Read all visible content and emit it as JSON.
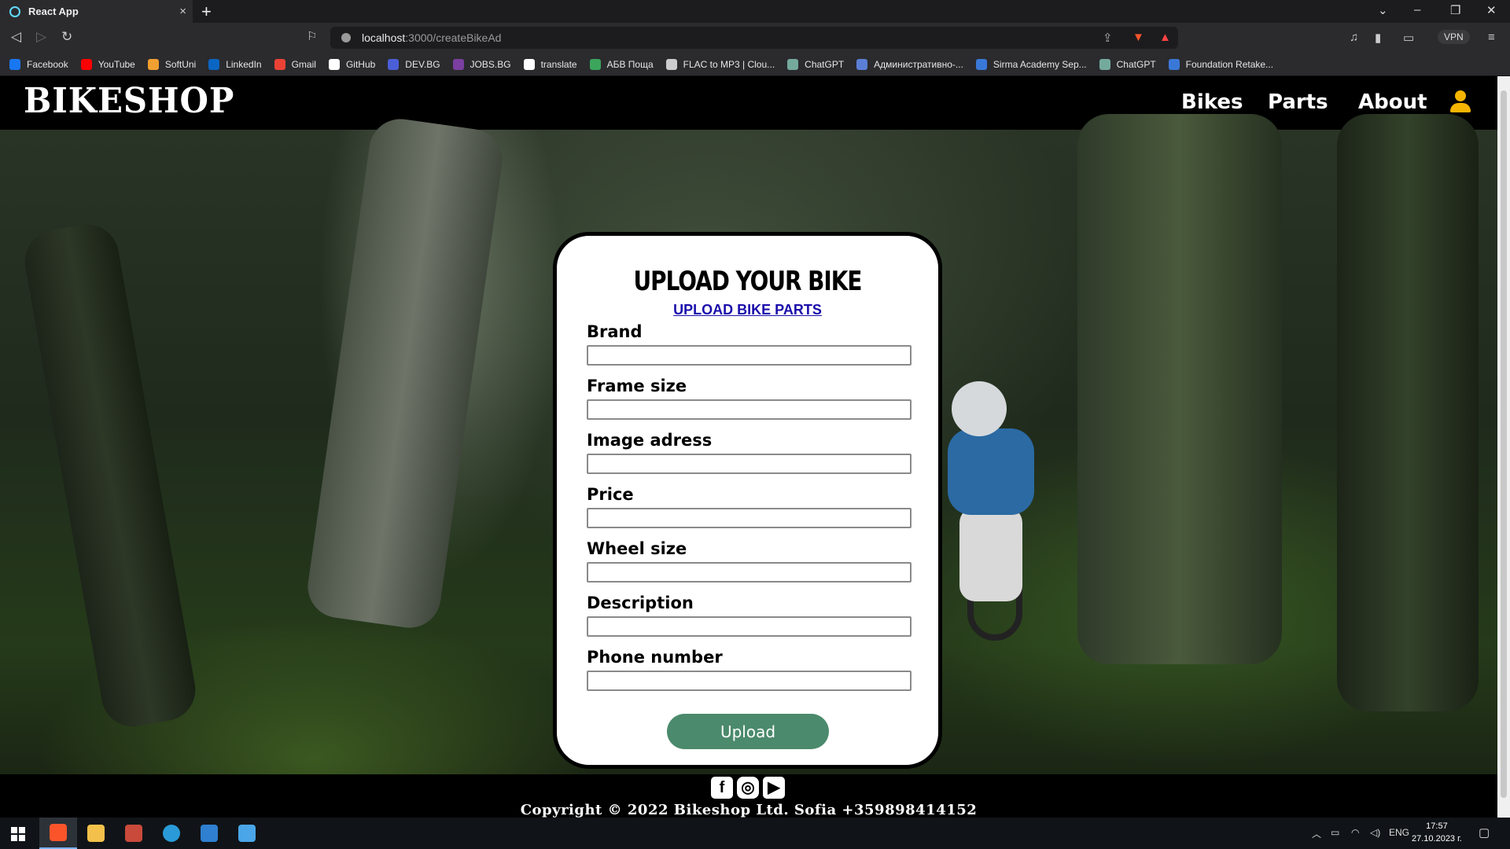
{
  "browser": {
    "tab_title": "React App",
    "tab_close": "×",
    "new_tab": "+",
    "url_host": "localhost",
    "url_path": ":3000/createBikeAd",
    "vpn_label": "VPN",
    "back": "◁",
    "forward": "▷",
    "reload": "↻",
    "minimize": "–",
    "maximize": "❐",
    "close": "✕",
    "tab_list": "⌄",
    "bookmarks": [
      {
        "label": "Facebook",
        "color": "#1877f2"
      },
      {
        "label": "YouTube",
        "color": "#ff0000"
      },
      {
        "label": "SoftUni",
        "color": "#f0a030"
      },
      {
        "label": "LinkedIn",
        "color": "#0a66c2"
      },
      {
        "label": "Gmail",
        "color": "#ea4335"
      },
      {
        "label": "GitHub",
        "color": "#ffffff"
      },
      {
        "label": "DEV.BG",
        "color": "#4a5fd8"
      },
      {
        "label": "JOBS.BG",
        "color": "#7b3fa0"
      },
      {
        "label": "translate",
        "color": "#ffffff"
      },
      {
        "label": "АБВ Поща",
        "color": "#3ba55c"
      },
      {
        "label": "FLAC to MP3 | Clou...",
        "color": "#cccccc"
      },
      {
        "label": "ChatGPT",
        "color": "#74aa9c"
      },
      {
        "label": "Административно-...",
        "color": "#5b7fd6"
      },
      {
        "label": "Sirma Academy Sep...",
        "color": "#3a78d8"
      },
      {
        "label": "ChatGPT",
        "color": "#74aa9c"
      },
      {
        "label": "Foundation Retake...",
        "color": "#3a78d8"
      }
    ]
  },
  "site": {
    "logo": "BIKESHOP",
    "nav": {
      "bikes": "Bikes",
      "parts": "Parts",
      "about": "About"
    },
    "accent_color": "#f5b400"
  },
  "form": {
    "title": "UPLOAD YOUR BIKE",
    "link": "UPLOAD BIKE PARTS",
    "fields": [
      {
        "label": "Brand",
        "value": ""
      },
      {
        "label": "Frame size",
        "value": ""
      },
      {
        "label": "Image adress",
        "value": ""
      },
      {
        "label": "Price",
        "value": ""
      },
      {
        "label": "Wheel size",
        "value": ""
      },
      {
        "label": "Description",
        "value": ""
      },
      {
        "label": "Phone number",
        "value": ""
      }
    ],
    "submit": "Upload",
    "button_color": "#4b8a6c"
  },
  "footer": {
    "copyright": "Copyright © 2022 Bikeshop Ltd. Sofia +359898414152",
    "social": [
      "facebook-icon",
      "instagram-icon",
      "youtube-icon"
    ]
  },
  "taskbar": {
    "lang": "ENG",
    "time": "17:57",
    "date": "27.10.2023 г."
  }
}
